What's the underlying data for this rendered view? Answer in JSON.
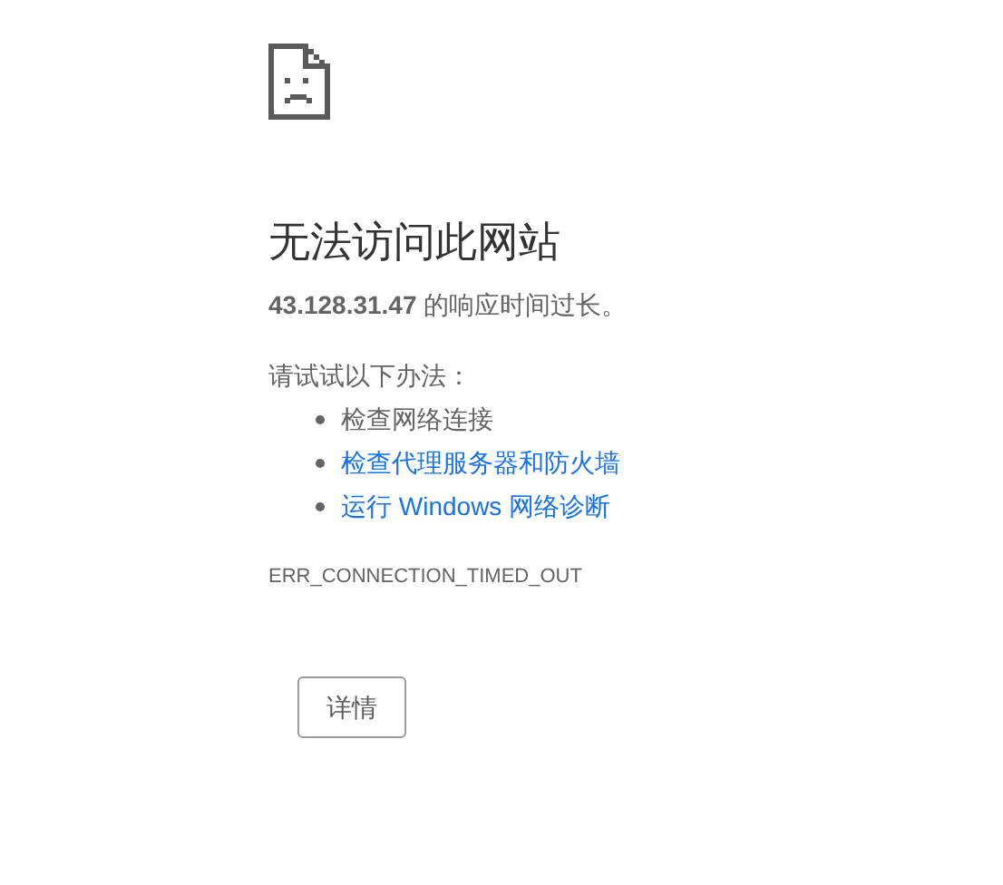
{
  "heading": "无法访问此网站",
  "summary": "**43.128.31.47** 的响应时间过长。",
  "suggestions_title": "请试试以下办法：",
  "suggestions": [
    {
      "kind": "text",
      "label": "检查网络连接"
    },
    {
      "kind": "link",
      "label": "检查代理服务器和防火墙"
    },
    {
      "kind": "link",
      "label": "运行 Windows 网络诊断"
    }
  ],
  "error_code": "ERR_CONNECTION_TIMED_OUT",
  "details_button": "详情"
}
